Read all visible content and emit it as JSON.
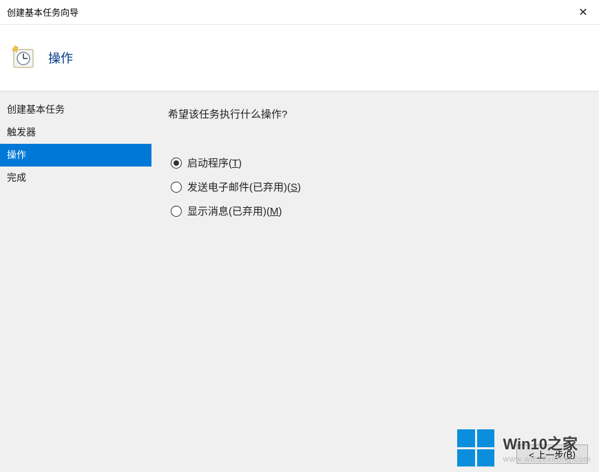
{
  "window": {
    "title": "创建基本任务向导",
    "close_glyph": "✕"
  },
  "header": {
    "title": "操作"
  },
  "sidebar": {
    "items": [
      {
        "label": "创建基本任务",
        "active": false
      },
      {
        "label": "触发器",
        "active": false
      },
      {
        "label": "操作",
        "active": true
      },
      {
        "label": "完成",
        "active": false
      }
    ]
  },
  "main": {
    "prompt": "希望该任务执行什么操作?",
    "options": [
      {
        "label_prefix": "启动程序(",
        "mnemonic": "T",
        "label_suffix": ")",
        "selected": true
      },
      {
        "label_prefix": "发送电子邮件(已弃用)(",
        "mnemonic": "S",
        "label_suffix": ")",
        "selected": false
      },
      {
        "label_prefix": "显示消息(已弃用)(",
        "mnemonic": "M",
        "label_suffix": ")",
        "selected": false
      }
    ],
    "buttons": {
      "back_prefix": "< 上一步(",
      "back_mnemonic": "B",
      "back_suffix": ")"
    }
  },
  "watermark": {
    "brand_en": "Win10",
    "brand_zh": "之家",
    "url": "www.win10xitong.com"
  }
}
